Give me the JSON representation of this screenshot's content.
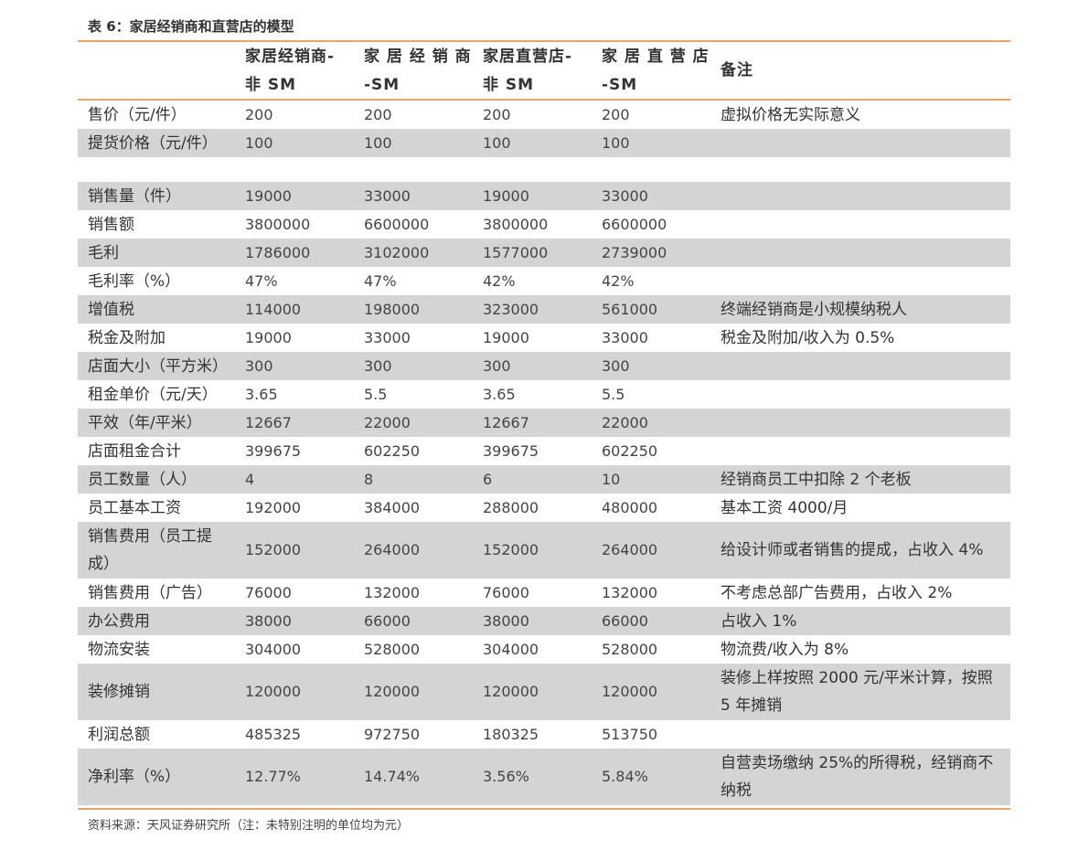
{
  "title": "表 6：家居经销商和直营店的模型",
  "headers": [
    {
      "line1": "",
      "line2": ""
    },
    {
      "line1": "家居经销商-",
      "line2": "非 SM"
    },
    {
      "line1": "家 居 经 销 商",
      "line2": "-SM"
    },
    {
      "line1": "家居直营店-",
      "line2": "非 SM"
    },
    {
      "line1": "家 居 直 营 店",
      "line2": "-SM"
    },
    {
      "line1": "备注",
      "line2": ""
    }
  ],
  "rows": [
    {
      "label": "售价（元/件）",
      "v1": "200",
      "v2": "200",
      "v3": "200",
      "v4": "200",
      "note": "虚拟价格无实际意义"
    },
    {
      "label": "提货价格（元/件）",
      "v1": "100",
      "v2": "100",
      "v3": "100",
      "v4": "100",
      "note": ""
    },
    {
      "label": "",
      "v1": "",
      "v2": "",
      "v3": "",
      "v4": "",
      "note": ""
    },
    {
      "label": "销售量（件）",
      "v1": "19000",
      "v2": "33000",
      "v3": "19000",
      "v4": "33000",
      "note": ""
    },
    {
      "label": "销售额",
      "v1": "3800000",
      "v2": "6600000",
      "v3": "3800000",
      "v4": "6600000",
      "note": ""
    },
    {
      "label": "毛利",
      "v1": "1786000",
      "v2": "3102000",
      "v3": "1577000",
      "v4": "2739000",
      "note": ""
    },
    {
      "label": "毛利率（%）",
      "v1": "47%",
      "v2": "47%",
      "v3": "42%",
      "v4": "42%",
      "note": ""
    },
    {
      "label": "增值税",
      "v1": "114000",
      "v2": "198000",
      "v3": "323000",
      "v4": "561000",
      "note": "终端经销商是小规模纳税人"
    },
    {
      "label": "税金及附加",
      "v1": "19000",
      "v2": "33000",
      "v3": "19000",
      "v4": "33000",
      "note": "税金及附加/收入为 0.5%"
    },
    {
      "label": "店面大小（平方米）",
      "v1": "300",
      "v2": "300",
      "v3": "300",
      "v4": "300",
      "note": ""
    },
    {
      "label": "租金单价（元/天）",
      "v1": "3.65",
      "v2": "5.5",
      "v3": "3.65",
      "v4": "5.5",
      "note": ""
    },
    {
      "label": "平效（年/平米）",
      "v1": "12667",
      "v2": "22000",
      "v3": "12667",
      "v4": "22000",
      "note": ""
    },
    {
      "label": "店面租金合计",
      "v1": "399675",
      "v2": "602250",
      "v3": "399675",
      "v4": "602250",
      "note": ""
    },
    {
      "label": "员工数量（人）",
      "v1": "4",
      "v2": "8",
      "v3": "6",
      "v4": "10",
      "note": "经销商员工中扣除 2 个老板"
    },
    {
      "label": "员工基本工资",
      "v1": "192000",
      "v2": "384000",
      "v3": "288000",
      "v4": "480000",
      "note": "基本工资 4000/月"
    },
    {
      "label": "销售费用（员工提成）",
      "v1": "152000",
      "v2": "264000",
      "v3": "152000",
      "v4": "264000",
      "note": "给设计师或者销售的提成，占收入 4%"
    },
    {
      "label": "销售费用（广告）",
      "v1": "76000",
      "v2": "132000",
      "v3": "76000",
      "v4": "132000",
      "note": "不考虑总部广告费用，占收入 2%"
    },
    {
      "label": "办公费用",
      "v1": "38000",
      "v2": "66000",
      "v3": "38000",
      "v4": "66000",
      "note": "占收入 1%"
    },
    {
      "label": "物流安装",
      "v1": "304000",
      "v2": "528000",
      "v3": "304000",
      "v4": "528000",
      "note": "物流费/收入为 8%"
    },
    {
      "label": "装修摊销",
      "v1": "120000",
      "v2": "120000",
      "v3": "120000",
      "v4": "120000",
      "note": "装修上样按照 2000 元/平米计算，按照 5 年摊销"
    },
    {
      "label": "利润总额",
      "v1": "485325",
      "v2": "972750",
      "v3": "180325",
      "v4": "513750",
      "note": ""
    },
    {
      "label": "净利率（%）",
      "v1": "12.77%",
      "v2": "14.74%",
      "v3": "3.56%",
      "v4": "5.84%",
      "note": "自营卖场缴纳 25%的所得税，经销商不纳税"
    }
  ],
  "source": "资料来源：天风证券研究所（注：未特别注明的单位均为元）"
}
